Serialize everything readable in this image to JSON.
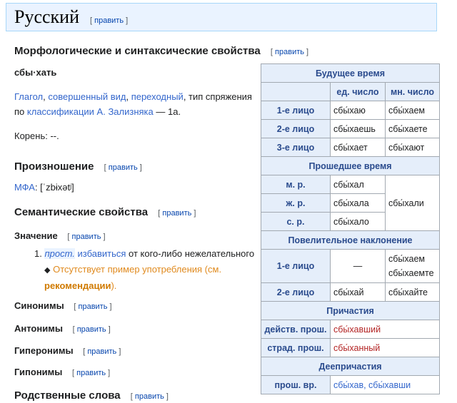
{
  "language": {
    "title": "Русский",
    "edit": "править"
  },
  "morph": {
    "heading": "Морфологические и синтаксические свойства",
    "edit": "править",
    "word": "сбы·хать",
    "desc": {
      "pos": "Глагол",
      "aspect": "совершенный вид",
      "trans": "переходный",
      "text1": ", тип спряжения",
      "text2": "по",
      "class": "классификации А. Зализняка",
      "tail": "— 1a."
    },
    "root": "Корень: --."
  },
  "pron": {
    "heading": "Произношение",
    "edit": "править",
    "ipa_label": "МФА",
    "ipa": ": [ˈzbɨxətʲ]"
  },
  "sem": {
    "heading": "Семантические свойства",
    "edit": "править",
    "meaning_heading": "Значение",
    "meaning_edit": "править",
    "def_num": "1.",
    "def_label": "прост.",
    "def_link": "избавиться",
    "def_rest": "от кого-либо нежелательного",
    "missing": "Отсутствует пример употребления (см.",
    "missing_link": "рекомендации",
    "missing_end": ")."
  },
  "sections": [
    {
      "label": "Синонимы",
      "edit": "править"
    },
    {
      "label": "Антонимы",
      "edit": "править"
    },
    {
      "label": "Гиперонимы",
      "edit": "править"
    },
    {
      "label": "Гипонимы",
      "edit": "править"
    }
  ],
  "related": {
    "heading": "Родственные слова",
    "edit": "править"
  },
  "table": {
    "future": "Будущее время",
    "col_sg": "ед. число",
    "col_pl": "мн. число",
    "future_rows": [
      {
        "p": "1-е лицо",
        "sg": "сбы́хаю",
        "pl": "сбы́хаем"
      },
      {
        "p": "2-е лицо",
        "sg": "сбы́хаешь",
        "pl": "сбы́хаете"
      },
      {
        "p": "3-е лицо",
        "sg": "сбы́хает",
        "pl": "сбы́хают"
      }
    ],
    "past": "Прошедшее время",
    "past_rows": [
      {
        "p": "м. р.",
        "v": "сбы́хал"
      },
      {
        "p": "ж. р.",
        "v": "сбы́хала"
      },
      {
        "p": "с. р.",
        "v": "сбы́хало"
      }
    ],
    "past_pl": "сбы́хали",
    "imper": "Повелительное наклонение",
    "imper_rows": [
      {
        "p": "1-е лицо",
        "sg": "—",
        "pl1": "сбы́хаем",
        "pl2": "сбы́хаемте"
      },
      {
        "p": "2-е лицо",
        "sg": "сбы́хай",
        "pl": "сбы́хайте"
      }
    ],
    "part": "Причастия",
    "part_rows": [
      {
        "p": "действ. прош.",
        "v": "сбы́хавший"
      },
      {
        "p": "страд. прош.",
        "v": "сбы́ханный"
      }
    ],
    "ger": "Деепричастия",
    "ger_rows": [
      {
        "p": "прош. вр.",
        "v": "сбы́хав, сбы́хавши"
      }
    ]
  }
}
